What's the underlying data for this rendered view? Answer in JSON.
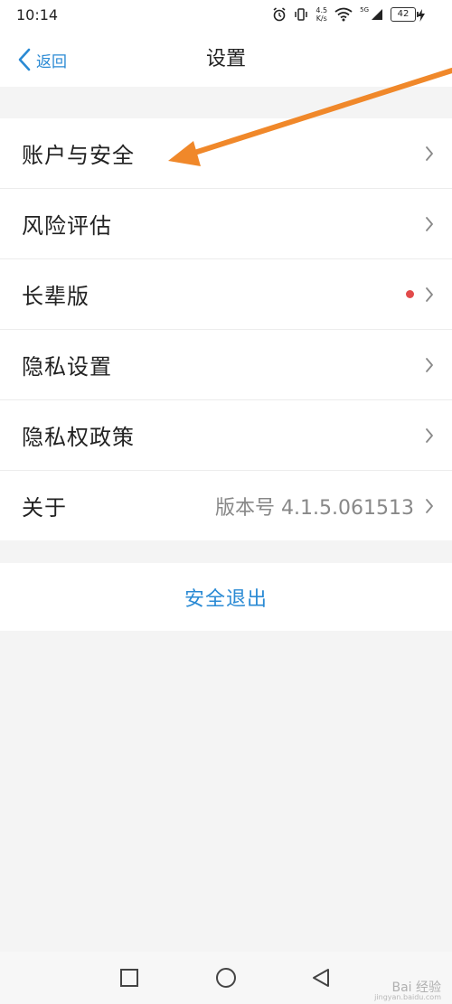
{
  "status_bar": {
    "time": "10:14",
    "speed_value": "4.5",
    "speed_unit": "K/s",
    "network": "5G",
    "battery": "42"
  },
  "header": {
    "back_label": "返回",
    "title": "设置"
  },
  "settings": [
    {
      "label": "账户与安全",
      "value": "",
      "has_dot": false
    },
    {
      "label": "风险评估",
      "value": "",
      "has_dot": false
    },
    {
      "label": "长辈版",
      "value": "",
      "has_dot": true
    },
    {
      "label": "隐私设置",
      "value": "",
      "has_dot": false
    },
    {
      "label": "隐私权政策",
      "value": "",
      "has_dot": false
    },
    {
      "label": "关于",
      "value": "版本号 4.1.5.061513",
      "has_dot": false
    }
  ],
  "logout": {
    "label": "安全退出"
  },
  "watermark": {
    "text": "Bai 经验",
    "url": "jingyan.baidu.com"
  },
  "icons": {
    "back": "chevron-left-icon",
    "row_arrow": "chevron-right-icon",
    "nav": [
      "square-icon",
      "circle-icon",
      "triangle-back-icon"
    ]
  },
  "colors": {
    "accent": "#2a8ad4",
    "dot": "#e24b4b",
    "annotation_arrow": "#f0882a",
    "background": "#f4f4f4"
  }
}
